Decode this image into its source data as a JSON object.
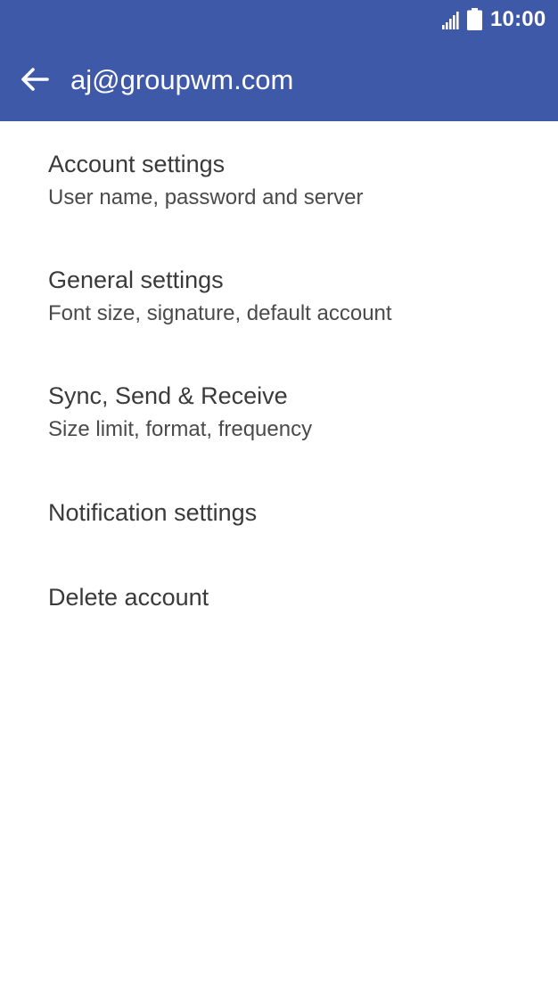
{
  "status_bar": {
    "time": "10:00",
    "signal_icon": "signal-bars-icon",
    "battery_icon": "battery-full-icon"
  },
  "app_bar": {
    "back_icon": "arrow-left-icon",
    "title": "aj@groupwm.com",
    "background_color": "#3f59a9"
  },
  "menu": {
    "items": [
      {
        "title": "Account settings",
        "subtitle": "User name, password and server"
      },
      {
        "title": "General settings",
        "subtitle": "Font size, signature, default account"
      },
      {
        "title": "Sync, Send & Receive",
        "subtitle": "Size limit, format, frequency"
      },
      {
        "title": "Notification settings"
      },
      {
        "title": "Delete account"
      }
    ]
  }
}
